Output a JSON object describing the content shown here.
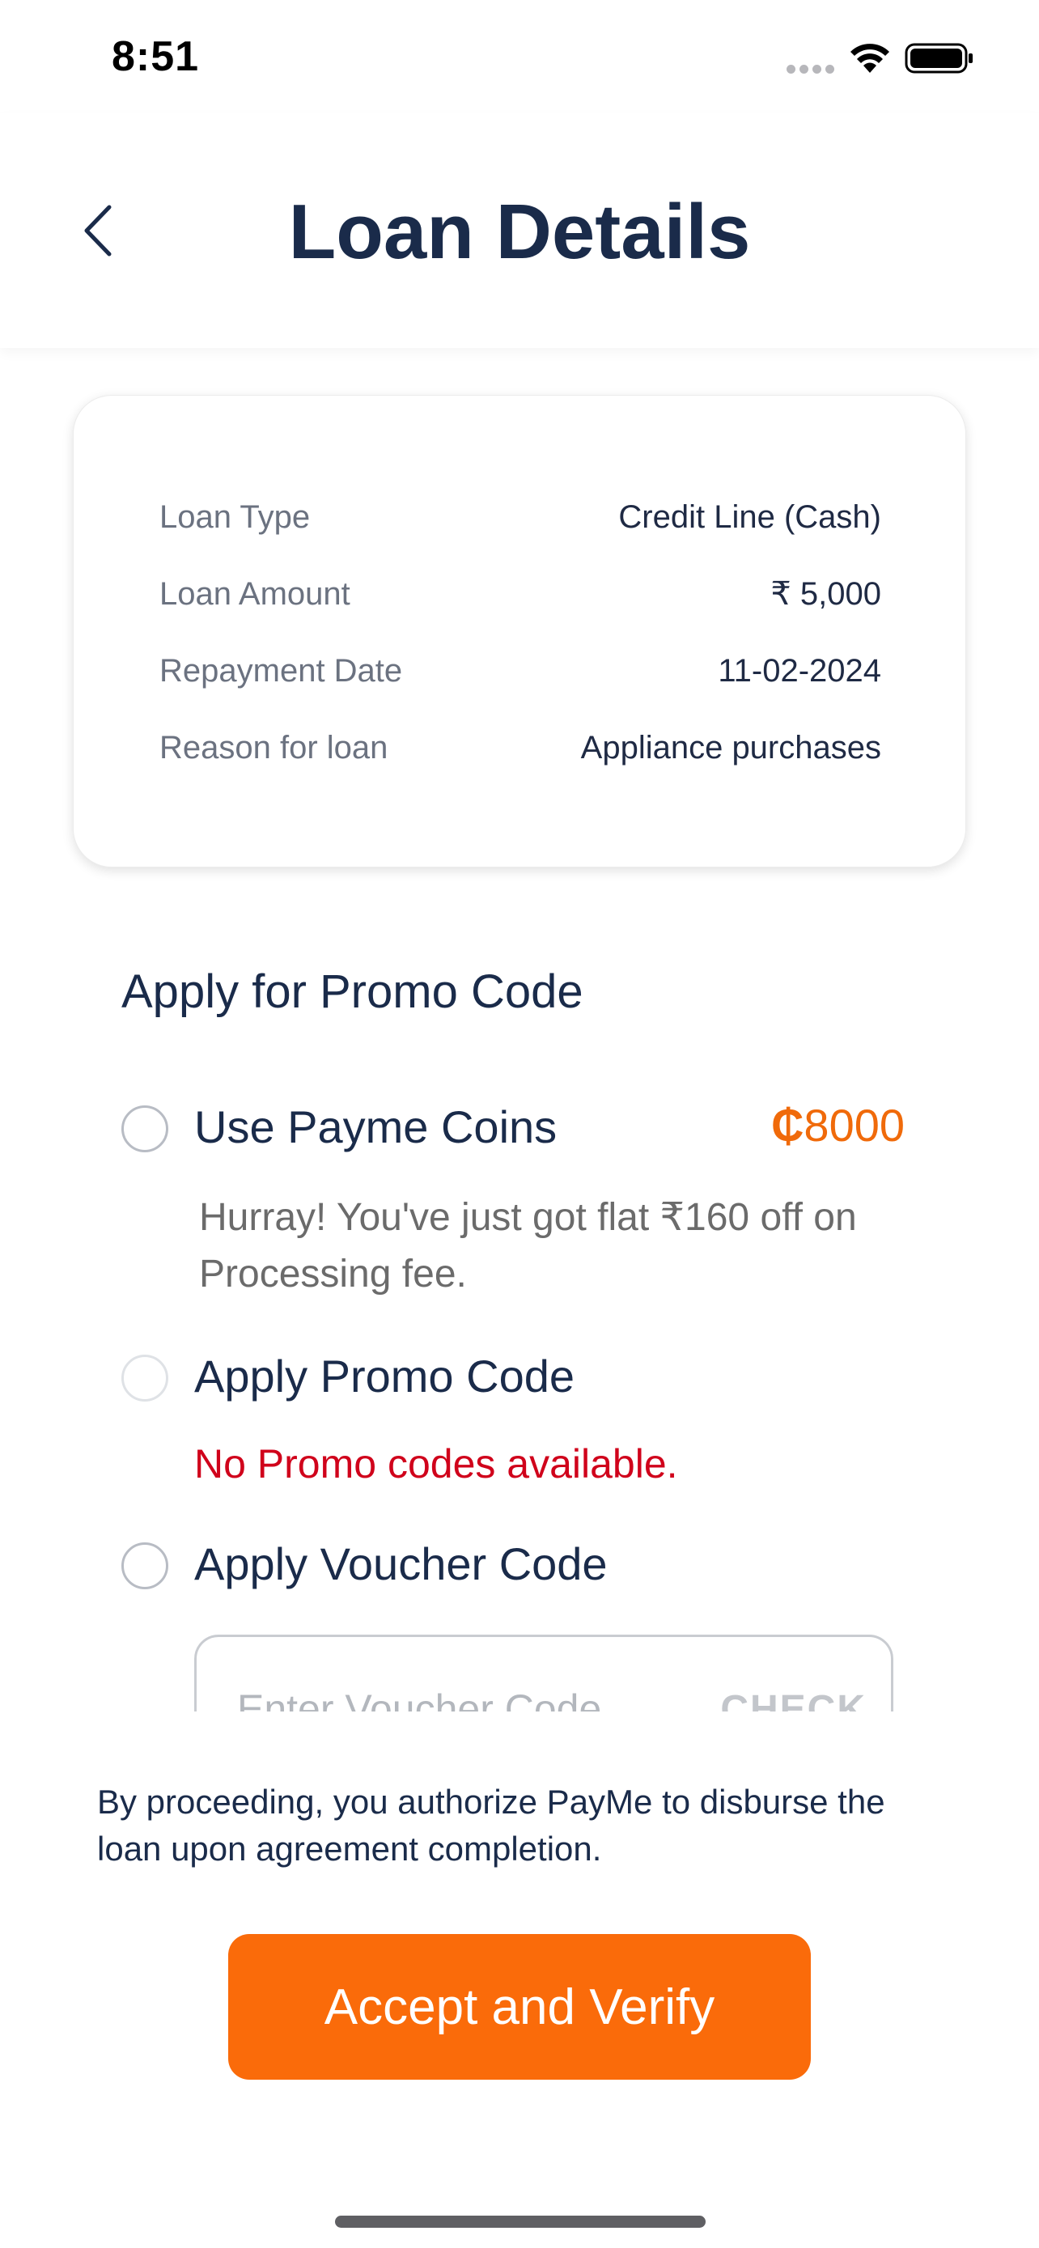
{
  "status_bar": {
    "time": "8:51"
  },
  "header": {
    "title": "Loan Details"
  },
  "loan_details": [
    {
      "label": "Loan Type",
      "value": "Credit Line (Cash)"
    },
    {
      "label": "Loan Amount",
      "value": "₹ 5,000"
    },
    {
      "label": "Repayment Date",
      "value": "11-02-2024"
    },
    {
      "label": "Reason for loan",
      "value": "Appliance purchases"
    }
  ],
  "promo": {
    "heading": "Apply for Promo Code",
    "coins": {
      "label": "Use Payme Coins",
      "currency_symbol": "₵",
      "amount": "8000",
      "benefit": "Hurray! You've just got flat ₹160 off on Processing fee."
    },
    "promo_code": {
      "label": "Apply Promo Code",
      "message": "No Promo codes available."
    },
    "voucher": {
      "label": "Apply Voucher Code",
      "placeholder": "Enter Voucher Code",
      "check_label": "CHECK"
    }
  },
  "footer": {
    "authorize_text": "By proceeding, you authorize PayMe to disburse the loan upon agreement completion.",
    "accept_label": "Accept and Verify"
  },
  "colors": {
    "accent": "#fa6b0a",
    "title": "#1a2b4a",
    "error": "#d0021b"
  }
}
